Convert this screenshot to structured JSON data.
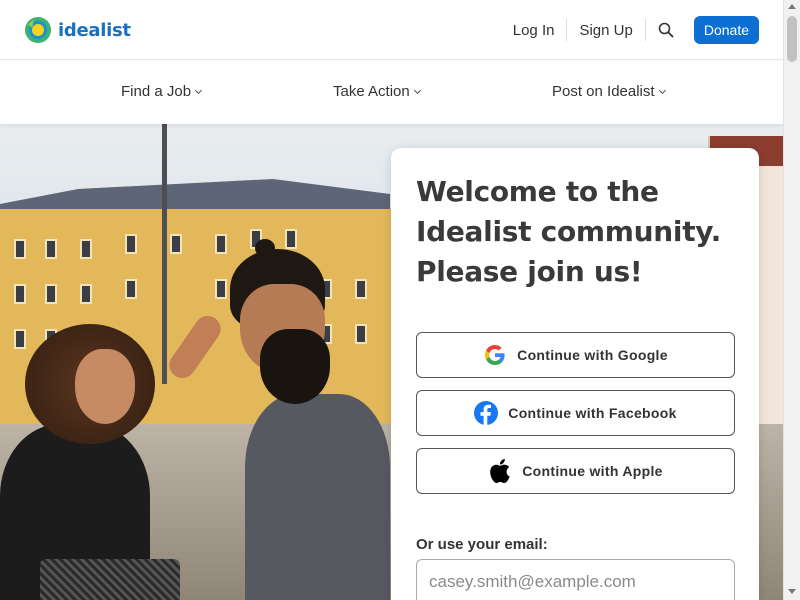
{
  "header": {
    "logo_text": "idealist",
    "login_label": "Log In",
    "signup_label": "Sign Up",
    "search_icon": "search-icon",
    "donate_label": "Donate",
    "brand_color": "#0d6fd1"
  },
  "subnav": {
    "items": [
      {
        "label": "Find a Job"
      },
      {
        "label": "Take Action"
      },
      {
        "label": "Post on Idealist"
      }
    ]
  },
  "card": {
    "title": "Welcome to the Idealist community. Please join us!",
    "google_label": "Continue with Google",
    "facebook_label": "Continue with Facebook",
    "apple_label": "Continue with Apple",
    "email_label": "Or use your email:",
    "email_placeholder": "casey.smith@example.com"
  }
}
